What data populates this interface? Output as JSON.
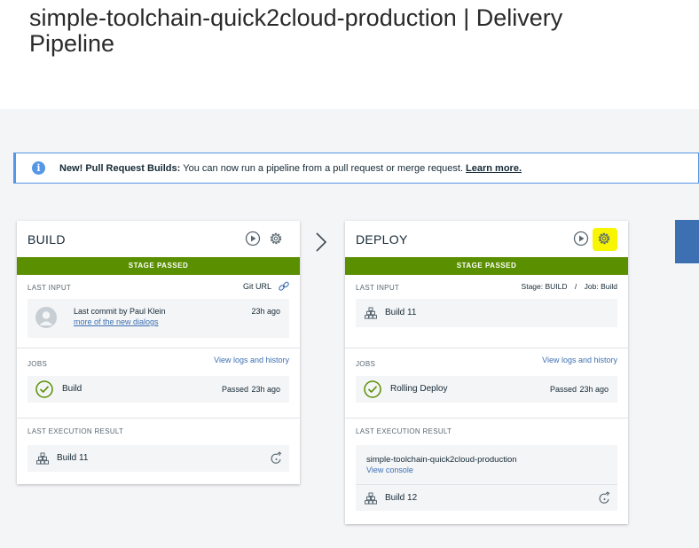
{
  "page": {
    "title": "simple-toolchain-quick2cloud-production | Delivery Pipeline"
  },
  "notice": {
    "bold": "New! Pull Request Builds:",
    "text": "You can now run a pipeline from a pull request or merge request.",
    "link": "Learn more.",
    "icon": "info-icon"
  },
  "build": {
    "name": "BUILD",
    "status": "STAGE PASSED",
    "last_input": {
      "label": "LAST INPUT",
      "link": "Git URL",
      "commit": "Last commit by Paul Klein",
      "time": "23h ago",
      "message": "more of the new dialogs"
    },
    "jobs": {
      "label": "JOBS",
      "link": "View logs and history",
      "job_name": "Build",
      "job_status": "Passed",
      "job_time": "23h ago"
    },
    "last_result": {
      "label": "LAST EXECUTION RESULT",
      "build": "Build 11"
    }
  },
  "deploy": {
    "name": "DEPLOY",
    "status": "STAGE PASSED",
    "last_input": {
      "label": "LAST INPUT",
      "stage": "Stage: BUILD",
      "separator": "/",
      "job": "Job: Build",
      "build": "Build 11"
    },
    "jobs": {
      "label": "JOBS",
      "link": "View logs and history",
      "job_name": "Rolling Deploy",
      "job_status": "Passed",
      "job_time": "23h ago"
    },
    "last_result": {
      "label": "LAST EXECUTION RESULT",
      "app": "simple-toolchain-quick2cloud-production",
      "console": "View console",
      "build": "Build 12"
    }
  },
  "colors": {
    "passed": "#5a8f00",
    "link": "#3d70b2",
    "highlight": "#f7f500",
    "notice_border": "#5596e6"
  }
}
